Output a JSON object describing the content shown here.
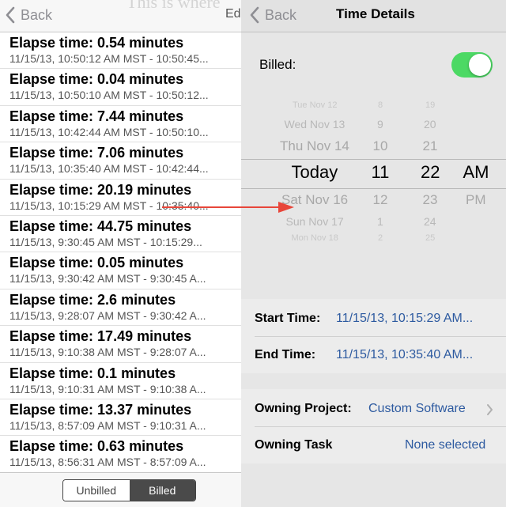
{
  "left": {
    "nav": {
      "back_label": "Back",
      "ghost_title": "This is where",
      "edit_label": "Ed"
    },
    "rows": [
      {
        "elapsed": "Elapse time: 0.54 minutes",
        "range": "11/15/13, 10:50:12 AM MST - 10:50:45..."
      },
      {
        "elapsed": "Elapse time: 0.04 minutes",
        "range": "11/15/13, 10:50:10 AM MST - 10:50:12..."
      },
      {
        "elapsed": "Elapse time: 7.44 minutes",
        "range": "11/15/13, 10:42:44 AM MST - 10:50:10..."
      },
      {
        "elapsed": "Elapse time: 7.06 minutes",
        "range": "11/15/13, 10:35:40 AM MST - 10:42:44..."
      },
      {
        "elapsed": "Elapse time: 20.19 minutes",
        "range": "11/15/13, 10:15:29 AM MST - 10:35:40..."
      },
      {
        "elapsed": "Elapse time: 44.75 minutes",
        "range": "11/15/13, 9:30:45 AM MST - 10:15:29..."
      },
      {
        "elapsed": "Elapse time: 0.05 minutes",
        "range": "11/15/13, 9:30:42 AM MST - 9:30:45 A..."
      },
      {
        "elapsed": "Elapse time: 2.6 minutes",
        "range": "11/15/13, 9:28:07 AM MST - 9:30:42 A..."
      },
      {
        "elapsed": "Elapse time: 17.49 minutes",
        "range": "11/15/13, 9:10:38 AM MST - 9:28:07 A..."
      },
      {
        "elapsed": "Elapse time: 0.1 minutes",
        "range": "11/15/13, 9:10:31 AM MST - 9:10:38 A..."
      },
      {
        "elapsed": "Elapse time: 13.37 minutes",
        "range": "11/15/13, 8:57:09 AM MST - 9:10:31 A..."
      },
      {
        "elapsed": "Elapse time: 0.63 minutes",
        "range": "11/15/13, 8:56:31 AM MST - 8:57:09 A..."
      }
    ],
    "segment": {
      "unbilled": "Unbilled",
      "billed": "Billed",
      "selected": "Billed"
    }
  },
  "right": {
    "nav": {
      "back_label": "Back",
      "title": "Time Details"
    },
    "billed": {
      "label": "Billed:",
      "on": true
    },
    "picker": {
      "dates": [
        "Tue Nov 12",
        "Wed Nov 13",
        "Thu Nov 14",
        "Today",
        "Sat Nov 16",
        "Sun Nov 17",
        "Mon Nov 18"
      ],
      "hours": [
        "8",
        "9",
        "10",
        "11",
        "12",
        "1",
        "2"
      ],
      "minutes": [
        "19",
        "20",
        "21",
        "22",
        "23",
        "24",
        "25"
      ],
      "ampm": [
        "AM",
        "PM"
      ]
    },
    "start_time": {
      "label": "Start Time:",
      "value": "11/15/13, 10:15:29 AM..."
    },
    "end_time": {
      "label": "End Time:",
      "value": "11/15/13, 10:35:40 AM..."
    },
    "owning_project": {
      "label": "Owning Project:",
      "value": "Custom Software"
    },
    "owning_task": {
      "label": "Owning Task",
      "value": "None selected"
    }
  },
  "colors": {
    "toggle_on": "#4cd964",
    "link_blue": "#2d5aa0",
    "arrow_red": "#e8463a",
    "segment_selected": "#4a4a4a"
  }
}
